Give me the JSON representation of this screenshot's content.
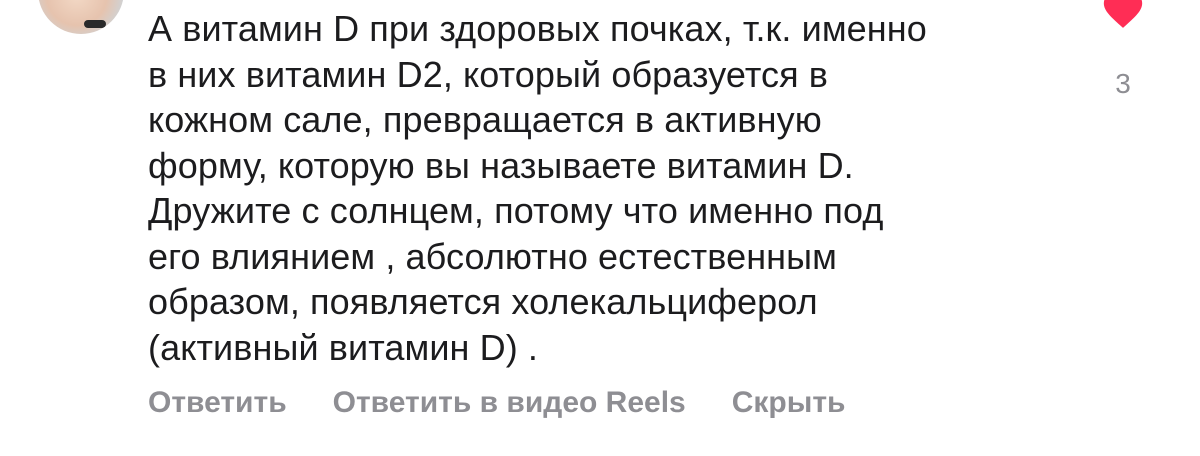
{
  "comment": {
    "lines": [
      "А витамин D при здоровых почках, т.к. именно",
      "в них витамин D2, который образуется в",
      "кожном сале, превращается в активную",
      "форму, которую вы называете витамин D.",
      "Дружите с солнцем, потому что именно под",
      "его влиянием , абсолютно естественным",
      "образом, появляется холекальциферол",
      "(активный витамин D) ."
    ]
  },
  "likes": {
    "count": "3",
    "icon": "heart-icon",
    "color": "#ff2d55"
  },
  "actions": {
    "reply_label": "Ответить",
    "reply_reels_label": "Ответить в видео Reels",
    "hide_label": "Скрыть"
  },
  "colors": {
    "text": "#1c1c1e",
    "muted": "#8e8e93",
    "background": "#ffffff"
  }
}
